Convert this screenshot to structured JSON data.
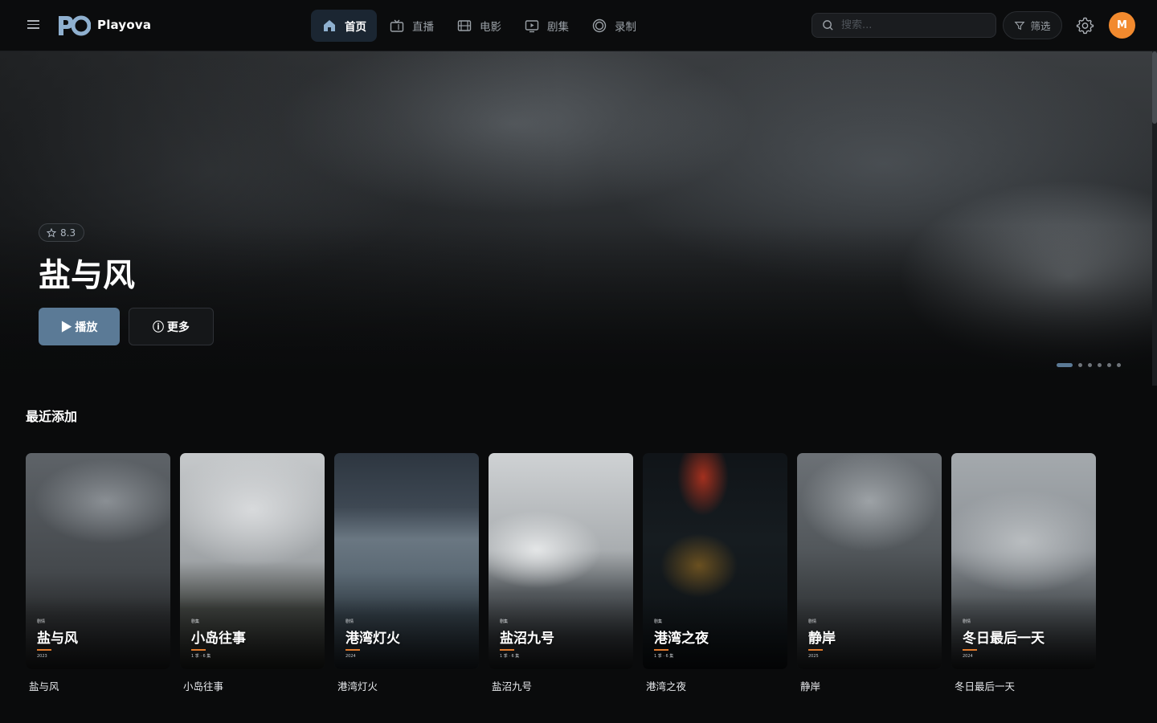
{
  "app": {
    "name": "Playova"
  },
  "nav": {
    "items": [
      {
        "label": "首页",
        "icon": "home-icon",
        "active": true
      },
      {
        "label": "直播",
        "icon": "live-tv-icon",
        "active": false
      },
      {
        "label": "电影",
        "icon": "film-icon",
        "active": false
      },
      {
        "label": "剧集",
        "icon": "tv-series-icon",
        "active": false
      },
      {
        "label": "录制",
        "icon": "record-icon",
        "active": false
      }
    ]
  },
  "search": {
    "placeholder": "搜索..."
  },
  "filter": {
    "label": "筛选",
    "icon": "filter-icon"
  },
  "user": {
    "initial": "M",
    "avatar_color": "#f28a2e"
  },
  "hero": {
    "rating": "8.3",
    "title": "盐与风",
    "play_label": "▶ 播放",
    "more_label": "ⓘ 更多",
    "slide_count": 6,
    "active_slide": 1
  },
  "recent": {
    "title": "最近添加",
    "items": [
      {
        "kind": "剧情",
        "title": "盐与风",
        "meta": "2023",
        "caption": "盐与风"
      },
      {
        "kind": "剧集",
        "title": "小岛往事",
        "meta": "1 季 · 6 集",
        "caption": "小岛往事"
      },
      {
        "kind": "剧情",
        "title": "港湾灯火",
        "meta": "2024",
        "caption": "港湾灯火"
      },
      {
        "kind": "剧集",
        "title": "盐沼九号",
        "meta": "1 季 · 6 集",
        "caption": "盐沼九号"
      },
      {
        "kind": "剧集",
        "title": "港湾之夜",
        "meta": "1 季 · 6 集",
        "caption": "港湾之夜"
      },
      {
        "kind": "剧情",
        "title": "静岸",
        "meta": "2025",
        "caption": "静岸"
      },
      {
        "kind": "剧情",
        "title": "冬日最后一天",
        "meta": "2024",
        "caption": "冬日最后一天"
      }
    ]
  },
  "colors": {
    "accent": "#5b7a96",
    "orange": "#e07a2c",
    "background": "#0a0b0c"
  }
}
